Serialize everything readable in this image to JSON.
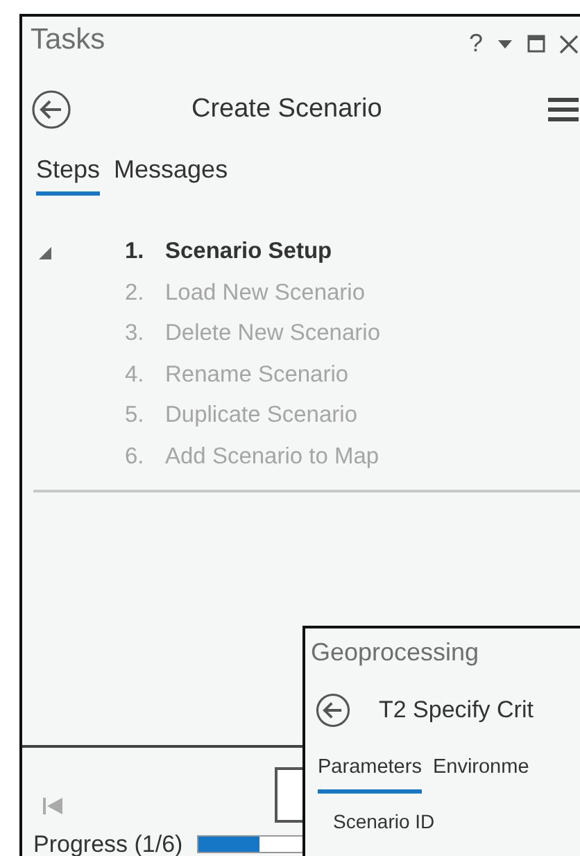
{
  "tasks_pane": {
    "title": "Tasks",
    "help": "?",
    "header": "Create Scenario",
    "tabs": [
      {
        "label": "Steps",
        "selected": true
      },
      {
        "label": "Messages",
        "selected": false
      }
    ],
    "steps": [
      {
        "number": "1.",
        "label": "Scenario Setup",
        "current": true,
        "expanded": true
      },
      {
        "number": "2.",
        "label": "Load New Scenario",
        "current": false,
        "expanded": false
      },
      {
        "number": "3.",
        "label": "Delete New Scenario",
        "current": false,
        "expanded": false
      },
      {
        "number": "4.",
        "label": "Rename Scenario",
        "current": false,
        "expanded": false
      },
      {
        "number": "5.",
        "label": "Duplicate Scenario",
        "current": false,
        "expanded": false
      },
      {
        "number": "6.",
        "label": "Add Scenario to Map",
        "current": false,
        "expanded": false
      }
    ],
    "progress": {
      "label": "Progress (1/6)",
      "level": 0.17
    }
  },
  "geoprocessing_pane": {
    "title": "Geoprocessing",
    "header": "T2 Specify Crit",
    "tabs": [
      {
        "label": "Parameters",
        "selected": true
      },
      {
        "label": "Environme",
        "selected": false
      }
    ],
    "field_label": "Scenario ID"
  }
}
